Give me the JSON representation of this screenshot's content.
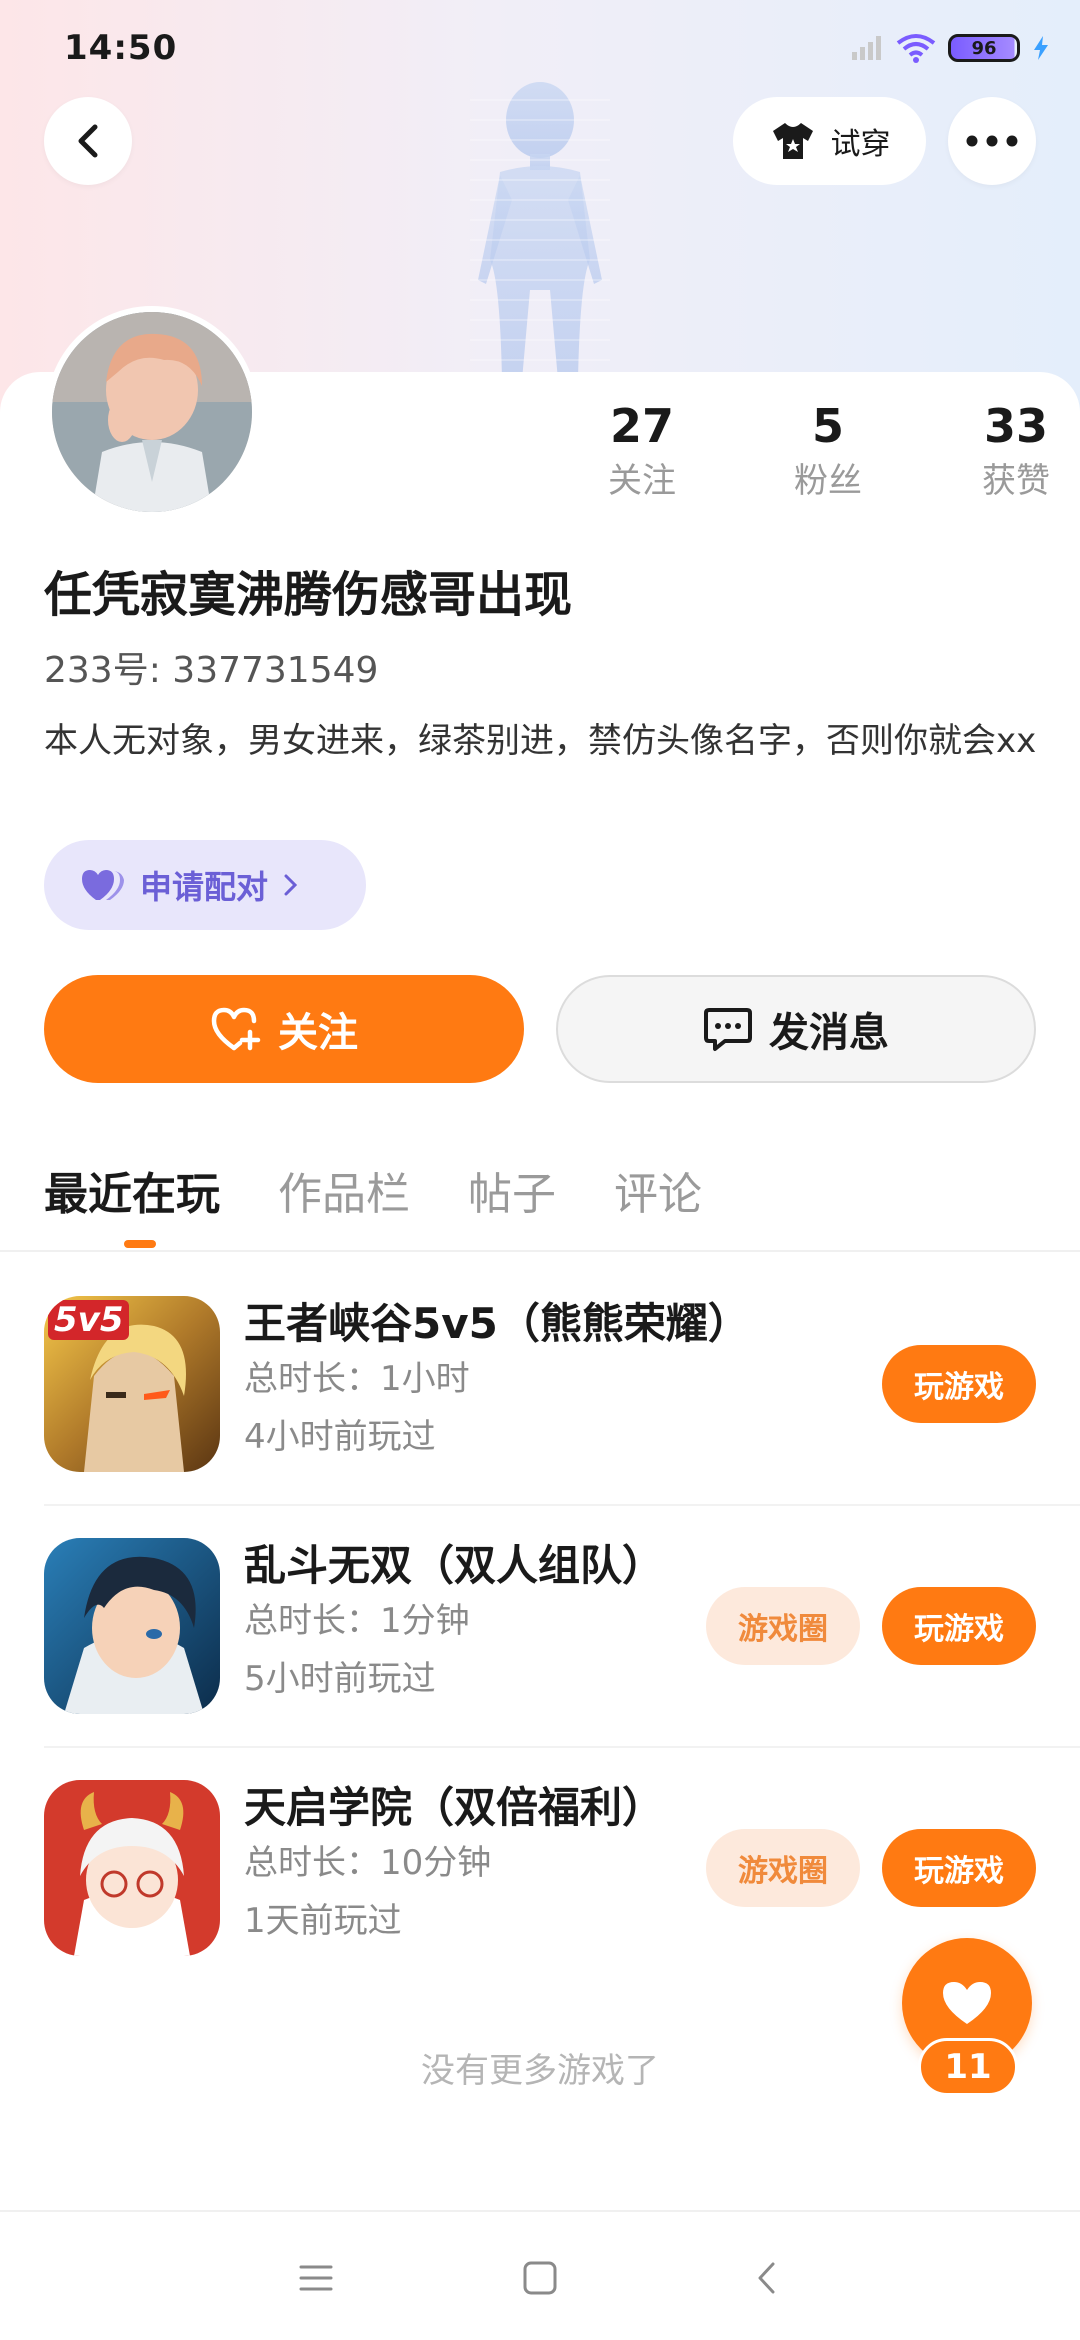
{
  "status_bar": {
    "time": "14:50",
    "battery": "96",
    "icons": [
      "signal-icon",
      "wifi-icon",
      "battery-icon",
      "charging-icon"
    ]
  },
  "header": {
    "back_icon": "chevron-left-icon",
    "tryon_label": "试穿",
    "more_icon": "more-dots-icon"
  },
  "profile": {
    "stats": [
      {
        "value": "27",
        "label": "关注"
      },
      {
        "value": "5",
        "label": "粉丝"
      },
      {
        "value": "33",
        "label": "获赞"
      }
    ],
    "nickname": "任凭寂寞沸腾伤感哥出现",
    "uid": "233号: 337731549",
    "bio": "本人无对象，男女进来，绿茶别进，禁仿头像名字，否则你就会xx",
    "pair_label": "申请配对",
    "follow_label": "关注",
    "message_label": "发消息"
  },
  "tabs": [
    {
      "label": "最近在玩",
      "active": true
    },
    {
      "label": "作品栏",
      "active": false
    },
    {
      "label": "帖子",
      "active": false
    },
    {
      "label": "评论",
      "active": false
    }
  ],
  "games": [
    {
      "title": "王者峡谷5v5（熊熊荣耀）",
      "duration": "总时长：1小时",
      "last_played": "4小时前玩过",
      "icon_badge": "5v5",
      "has_circle": false,
      "circle_label": "",
      "play_label": "玩游戏"
    },
    {
      "title": "乱斗无双（双人组队）",
      "duration": "总时长：1分钟",
      "last_played": "5小时前玩过",
      "has_circle": true,
      "circle_label": "游戏圈",
      "play_label": "玩游戏"
    },
    {
      "title": "天启学院（双倍福利）",
      "duration": "总时长：10分钟",
      "last_played": "1天前玩过",
      "has_circle": true,
      "circle_label": "游戏圈",
      "play_label": "玩游戏"
    }
  ],
  "footer_text": "没有更多游戏了",
  "like_fab": {
    "count": "11",
    "icon": "heart-icon"
  },
  "nav_bar": {
    "icons": [
      "menu-icon",
      "home-square-icon",
      "back-triangle-icon"
    ]
  },
  "colors": {
    "accent": "#ff7a12",
    "pair": "#6b5fd6",
    "pair_bg": "#e8e6fb"
  }
}
